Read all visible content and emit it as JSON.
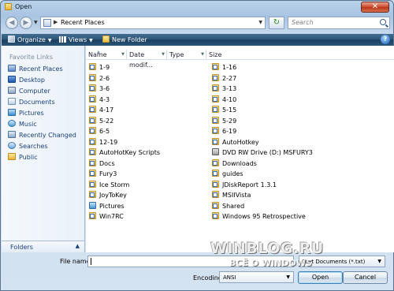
{
  "window": {
    "title": "Open",
    "close_symbol": "✕"
  },
  "address": {
    "back_symbol": "◀",
    "forward_symbol": "▶",
    "location": "Recent Places",
    "search_placeholder": "Search",
    "refresh_symbol": "↻"
  },
  "toolbar": {
    "organize_label": "Organize",
    "views_label": "Views",
    "new_folder_label": "New Folder",
    "help_symbol": "?"
  },
  "sidebar": {
    "heading": "Favorite Links",
    "items": [
      {
        "label": "Recent Places",
        "icon": "recent-places-icon"
      },
      {
        "label": "Desktop",
        "icon": "desktop-icon"
      },
      {
        "label": "Computer",
        "icon": "computer-icon"
      },
      {
        "label": "Documents",
        "icon": "documents-icon"
      },
      {
        "label": "Pictures",
        "icon": "pictures-icon"
      },
      {
        "label": "Music",
        "icon": "music-icon"
      },
      {
        "label": "Recently Changed",
        "icon": "recently-changed-icon"
      },
      {
        "label": "Searches",
        "icon": "searches-icon"
      },
      {
        "label": "Public",
        "icon": "public-folder-icon"
      }
    ],
    "folders_label": "Folders"
  },
  "file_list": {
    "columns": [
      "Name",
      "Date modif...",
      "Type",
      "Size"
    ],
    "left_column": [
      "1-9",
      "2-6",
      "3-6",
      "4-3",
      "4-17",
      "5-22",
      "6-5",
      "12-19",
      "AutoHotKey Scripts",
      "Docs",
      "Fury3",
      "Ice Storm",
      "JoyToKey",
      "Pictures",
      "Win7RC"
    ],
    "right_column": [
      "1-16",
      "2-27",
      "3-13",
      "4-10",
      "5-15",
      "5-29",
      "6-19",
      "AutoHotkey",
      "DVD RW Drive (D:) MSFURY3",
      "Downloads",
      "guides",
      "JDiskReport 1.3.1",
      "MSIIVista",
      "Shared",
      "Windows 95 Retrospective"
    ]
  },
  "bottom": {
    "filename_label": "File name:",
    "filename_value": "",
    "file_type": "Text Documents (*.txt)",
    "encoding_label": "Encoding:",
    "encoding_value": "ANSI",
    "open_label": "Open",
    "cancel_label": "Cancel"
  },
  "watermark": {
    "main": "WINBLOG.RU",
    "sub": "ВСЁ О WINDOWS"
  }
}
